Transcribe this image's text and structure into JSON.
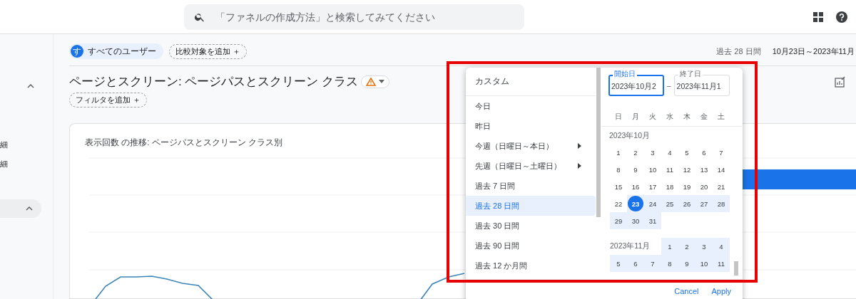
{
  "top_bar": {
    "search": {
      "placeholder": "「ファネルの作成方法」と検索してみてください"
    }
  },
  "sidebar": {
    "items": [
      {
        "kind": "header",
        "expanded": true
      },
      {
        "kind": "link",
        "label": "細"
      },
      {
        "kind": "link",
        "label": "細"
      },
      {
        "kind": "pill",
        "expanded": true
      }
    ]
  },
  "filters": {
    "segment": {
      "badge": "す",
      "label": "すべてのユーザー"
    },
    "compare_chip": "比較対象を追加 ＋"
  },
  "date_range": {
    "period": "過去 28 日間",
    "range": "10月23日～2023年11月"
  },
  "report": {
    "title": "ページとスクリーン: ページパスとスクリーン クラス",
    "filter_chip": "フィルタを追加 ＋"
  },
  "card": {
    "title": "表示回数 の推移: ページパスとスクリーン クラス別"
  },
  "date_picker": {
    "presets": [
      {
        "label": "カスタム",
        "selected": false,
        "has_submenu": false
      },
      {
        "label": "今日",
        "selected": false,
        "has_submenu": false
      },
      {
        "label": "昨日",
        "selected": false,
        "has_submenu": false
      },
      {
        "label": "今週（日曜日～本日）",
        "selected": false,
        "has_submenu": true
      },
      {
        "label": "先週（日曜日～土曜日）",
        "selected": false,
        "has_submenu": true
      },
      {
        "label": "過去 7 日間",
        "selected": false,
        "has_submenu": false
      },
      {
        "label": "過去 28 日間",
        "selected": true,
        "has_submenu": false
      },
      {
        "label": "過去 30 日間",
        "selected": false,
        "has_submenu": false
      },
      {
        "label": "過去 90 日間",
        "selected": false,
        "has_submenu": false
      },
      {
        "label": "過去 12 か月間",
        "selected": false,
        "has_submenu": false
      }
    ],
    "start_field": {
      "label": "開始日",
      "value": "2023年10月2"
    },
    "range_separator": "–",
    "end_field": {
      "label": "終了日",
      "value": "2023年11月1"
    },
    "weekdays": [
      "日",
      "月",
      "火",
      "水",
      "木",
      "金",
      "土"
    ],
    "months": [
      {
        "label": "2023年10月",
        "weeks": [
          [
            {
              "day": "1",
              "selected": false,
              "in_range": false
            },
            {
              "day": "2",
              "selected": false,
              "in_range": false
            },
            {
              "day": "3",
              "selected": false,
              "in_range": false
            },
            {
              "day": "4",
              "selected": false,
              "in_range": false
            },
            {
              "day": "5",
              "selected": false,
              "in_range": false
            },
            {
              "day": "6",
              "selected": false,
              "in_range": false
            },
            {
              "day": "7",
              "selected": false,
              "in_range": false
            }
          ],
          [
            {
              "day": "8",
              "selected": false,
              "in_range": false
            },
            {
              "day": "9",
              "selected": false,
              "in_range": false
            },
            {
              "day": "10",
              "selected": false,
              "in_range": false
            },
            {
              "day": "11",
              "selected": false,
              "in_range": false
            },
            {
              "day": "12",
              "selected": false,
              "in_range": false
            },
            {
              "day": "13",
              "selected": false,
              "in_range": false
            },
            {
              "day": "14",
              "selected": false,
              "in_range": false
            }
          ],
          [
            {
              "day": "15",
              "selected": false,
              "in_range": false
            },
            {
              "day": "16",
              "selected": false,
              "in_range": false
            },
            {
              "day": "17",
              "selected": false,
              "in_range": false
            },
            {
              "day": "18",
              "selected": false,
              "in_range": false
            },
            {
              "day": "19",
              "selected": false,
              "in_range": false
            },
            {
              "day": "20",
              "selected": false,
              "in_range": false
            },
            {
              "day": "21",
              "selected": false,
              "in_range": false
            }
          ],
          [
            {
              "day": "22",
              "selected": false,
              "in_range": false
            },
            {
              "day": "23",
              "selected": true,
              "in_range": true
            },
            {
              "day": "24",
              "selected": false,
              "in_range": true
            },
            {
              "day": "25",
              "selected": false,
              "in_range": true
            },
            {
              "day": "26",
              "selected": false,
              "in_range": true
            },
            {
              "day": "27",
              "selected": false,
              "in_range": true
            },
            {
              "day": "28",
              "selected": false,
              "in_range": true
            }
          ],
          [
            {
              "day": "29",
              "selected": false,
              "in_range": true
            },
            {
              "day": "30",
              "selected": false,
              "in_range": true
            },
            {
              "day": "31",
              "selected": false,
              "in_range": true
            }
          ]
        ]
      },
      {
        "label": "2023年11月",
        "weeks": [
          [
            {
              "day": "1",
              "selected": false,
              "in_range": true
            },
            {
              "day": "2",
              "selected": false,
              "in_range": true
            },
            {
              "day": "3",
              "selected": false,
              "in_range": true
            },
            {
              "day": "4",
              "selected": false,
              "in_range": true
            }
          ],
          [
            {
              "day": "5",
              "selected": false,
              "in_range": true
            },
            {
              "day": "6",
              "selected": false,
              "in_range": true
            },
            {
              "day": "7",
              "selected": false,
              "in_range": true
            },
            {
              "day": "8",
              "selected": false,
              "in_range": true
            },
            {
              "day": "9",
              "selected": false,
              "in_range": true
            },
            {
              "day": "10",
              "selected": false,
              "in_range": true
            },
            {
              "day": "11",
              "selected": false,
              "in_range": true
            }
          ]
        ]
      }
    ],
    "buttons": [
      "Cancel",
      "Apply"
    ]
  }
}
